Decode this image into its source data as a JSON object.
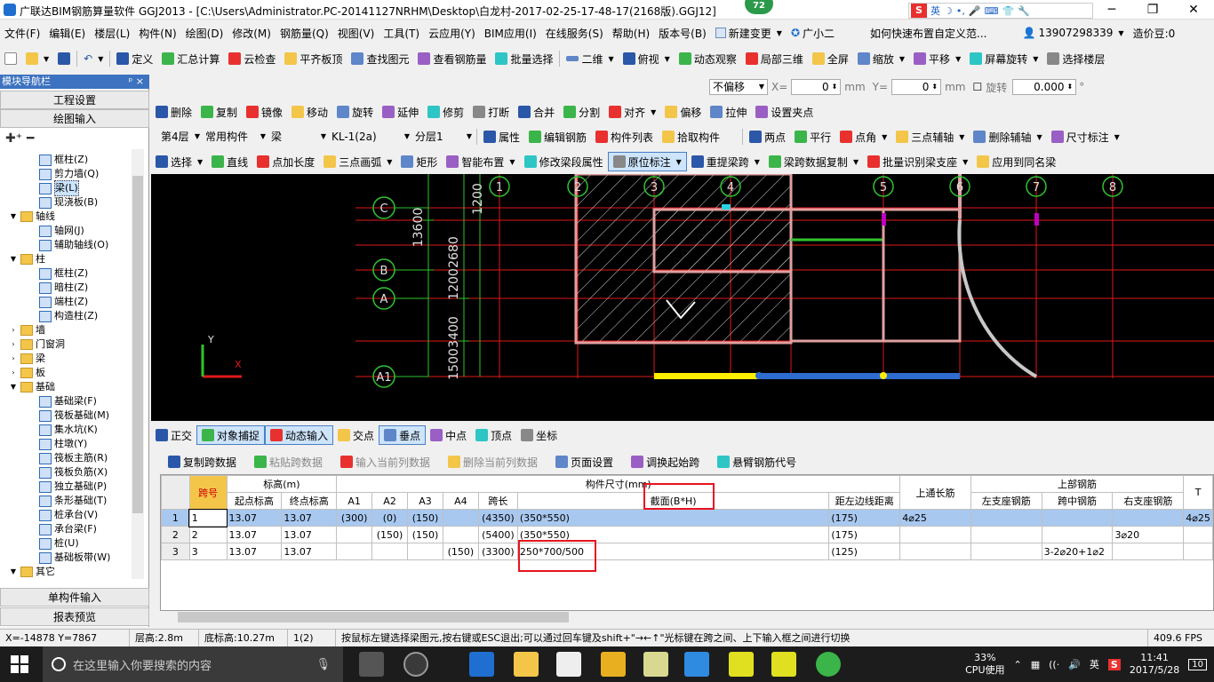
{
  "window": {
    "title": "广联达BIM钢筋算量软件 GGJ2013 - [C:\\Users\\Administrator.PC-20141127NRHM\\Desktop\\白龙村-2017-02-25-17-48-17(2168版).GGJ12]",
    "badge": "72",
    "ime_label": "英",
    "minimize": "─",
    "maximize": "❐",
    "close": "✕"
  },
  "menu": {
    "items": [
      "文件(F)",
      "编辑(E)",
      "楼层(L)",
      "构件(N)",
      "绘图(D)",
      "修改(M)",
      "钢筋量(Q)",
      "视图(V)",
      "工具(T)",
      "云应用(Y)",
      "BIM应用(I)",
      "在线服务(S)",
      "帮助(H)",
      "版本号(B)"
    ],
    "new_change": "新建变更",
    "assistant": "广小二",
    "question": "如何快速布置自定义范...",
    "phone": "13907298339",
    "coins": "造价豆:0"
  },
  "toolbar1": {
    "items": [
      "定义",
      "汇总计算",
      "云检查",
      "平齐板顶",
      "查找图元",
      "查看钢筋量",
      "批量选择"
    ],
    "view_mode": "二维",
    "tools": [
      "俯视",
      "动态观察",
      "局部三维",
      "全屏",
      "缩放",
      "平移",
      "屏幕旋转",
      "选择楼层"
    ]
  },
  "coord": {
    "offset_mode": "不偏移",
    "x_label": "X=",
    "x_value": "0",
    "y_label": "Y=",
    "y_value": "0",
    "unit": "mm",
    "rotate_label": "旋转",
    "rotate_value": "0.000",
    "deg": "°"
  },
  "toolbar2": {
    "items": [
      "删除",
      "复制",
      "镜像",
      "移动",
      "旋转",
      "延伸",
      "修剪",
      "打断",
      "合并",
      "分割",
      "对齐",
      "偏移",
      "拉伸",
      "设置夹点"
    ]
  },
  "toolbar3": {
    "floor": "第4层",
    "category": "常用构件",
    "type": "梁",
    "member": "KL-1(2a)",
    "layer": "分层1",
    "items": [
      "属性",
      "编辑钢筋",
      "构件列表",
      "拾取构件"
    ],
    "aux": [
      "两点",
      "平行",
      "点角",
      "三点辅轴",
      "删除辅轴",
      "尺寸标注"
    ]
  },
  "toolbar4": {
    "items": [
      "选择",
      "直线",
      "点加长度",
      "三点画弧",
      "矩形",
      "智能布置",
      "修改梁段属性",
      "原位标注",
      "重提梁跨",
      "梁跨数据复制",
      "批量识别梁支座",
      "应用到同名梁"
    ]
  },
  "nav": {
    "header": "模块导航栏",
    "pin": "ᵖ ×",
    "project_settings": "工程设置",
    "drawing_input": "绘图输入",
    "single_input": "单构件输入",
    "report": "报表预览",
    "tree": [
      {
        "label": "框柱(Z)",
        "level": 2,
        "kind": "item"
      },
      {
        "label": "剪力墙(Q)",
        "level": 2,
        "kind": "item"
      },
      {
        "label": "梁(L)",
        "level": 2,
        "kind": "item",
        "selected": true
      },
      {
        "label": "现浇板(B)",
        "level": 2,
        "kind": "item"
      },
      {
        "label": "轴线",
        "level": 1,
        "kind": "folder",
        "open": true
      },
      {
        "label": "轴网(J)",
        "level": 2,
        "kind": "item"
      },
      {
        "label": "辅助轴线(O)",
        "level": 2,
        "kind": "item"
      },
      {
        "label": "柱",
        "level": 1,
        "kind": "folder",
        "open": true
      },
      {
        "label": "框柱(Z)",
        "level": 2,
        "kind": "item"
      },
      {
        "label": "暗柱(Z)",
        "level": 2,
        "kind": "item"
      },
      {
        "label": "端柱(Z)",
        "level": 2,
        "kind": "item"
      },
      {
        "label": "构造柱(Z)",
        "level": 2,
        "kind": "item"
      },
      {
        "label": "墙",
        "level": 1,
        "kind": "folder",
        "open": false
      },
      {
        "label": "门窗洞",
        "level": 1,
        "kind": "folder",
        "open": false
      },
      {
        "label": "梁",
        "level": 1,
        "kind": "folder",
        "open": false
      },
      {
        "label": "板",
        "level": 1,
        "kind": "folder",
        "open": false
      },
      {
        "label": "基础",
        "level": 1,
        "kind": "folder",
        "open": true
      },
      {
        "label": "基础梁(F)",
        "level": 2,
        "kind": "item"
      },
      {
        "label": "筏板基础(M)",
        "level": 2,
        "kind": "item"
      },
      {
        "label": "集水坑(K)",
        "level": 2,
        "kind": "item"
      },
      {
        "label": "柱墩(Y)",
        "level": 2,
        "kind": "item"
      },
      {
        "label": "筏板主筋(R)",
        "level": 2,
        "kind": "item"
      },
      {
        "label": "筏板负筋(X)",
        "level": 2,
        "kind": "item"
      },
      {
        "label": "独立基础(P)",
        "level": 2,
        "kind": "item"
      },
      {
        "label": "条形基础(T)",
        "level": 2,
        "kind": "item"
      },
      {
        "label": "桩承台(V)",
        "level": 2,
        "kind": "item"
      },
      {
        "label": "承台梁(F)",
        "level": 2,
        "kind": "item"
      },
      {
        "label": "桩(U)",
        "level": 2,
        "kind": "item"
      },
      {
        "label": "基础板带(W)",
        "level": 2,
        "kind": "item"
      },
      {
        "label": "其它",
        "level": 1,
        "kind": "folder",
        "open": true
      }
    ]
  },
  "drawing": {
    "axis_numbers": [
      "1",
      "2",
      "3",
      "4",
      "5",
      "6",
      "7",
      "8"
    ],
    "axis_letters": [
      "C",
      "B",
      "A",
      "A1"
    ],
    "dims_left": [
      "13600",
      "2680",
      "1200",
      "3400",
      "1500"
    ],
    "dims_top": [
      "1200",
      "13600"
    ],
    "ucs_x": "X",
    "ucs_y": "Y"
  },
  "snap": {
    "items": [
      "正交",
      "对象捕捉",
      "动态输入",
      "交点",
      "垂点",
      "中点",
      "顶点",
      "坐标"
    ]
  },
  "gridtools": {
    "items": [
      "复制跨数据",
      "粘贴跨数据",
      "输入当前列数据",
      "删除当前列数据",
      "页面设置",
      "调换起始跨",
      "悬臂钢筋代号"
    ]
  },
  "table": {
    "group_headers": {
      "elev": "标高(m)",
      "size": "构件尺寸(mm)",
      "top": "上部钢筋"
    },
    "headers": [
      "跨号",
      "起点标高",
      "终点标高",
      "A1",
      "A2",
      "A3",
      "A4",
      "跨长",
      "截面(B*H)",
      "距左边线距离",
      "上通长筋",
      "左支座钢筋",
      "跨中钢筋",
      "右支座钢筋",
      "T"
    ],
    "rows": [
      {
        "n": "1",
        "span": "1",
        "start": "13.07",
        "end": "13.07",
        "a1": "(300)",
        "a2": "(0)",
        "a3": "(150)",
        "a4": "",
        "len": "(4350)",
        "sec": "(350*550)",
        "dist": "(175)",
        "top": "4⌀25",
        "left": "",
        "mid": "",
        "right": "",
        "t": "4⌀25"
      },
      {
        "n": "2",
        "span": "2",
        "start": "13.07",
        "end": "13.07",
        "a1": "",
        "a2": "(150)",
        "a3": "(150)",
        "a4": "",
        "len": "(5400)",
        "sec": "(350*550)",
        "dist": "(175)",
        "top": "",
        "left": "",
        "mid": "",
        "right": "3⌀20",
        "t": ""
      },
      {
        "n": "3",
        "span": "3",
        "start": "13.07",
        "end": "13.07",
        "a1": "",
        "a2": "",
        "a3": "",
        "a4": "(150)",
        "len": "(3300)",
        "sec": "250*700/500",
        "dist": "(125)",
        "top": "",
        "left": "",
        "mid": "3-2⌀20+1⌀2",
        "right": "",
        "t": ""
      }
    ]
  },
  "status": {
    "coords": "X=-14878  Y=7867",
    "floor_height": "层高:2.8m",
    "bottom_elev": "底标高:10.27m",
    "count": "1(2)",
    "hint": "按鼠标左键选择梁图元,按右键或ESC退出;可以通过回车键及shift+\"→←↑\"光标键在跨之间、上下输入框之间进行切换",
    "fps": "409.6 FPS"
  },
  "taskbar": {
    "search_placeholder": "在这里输入你要搜索的内容",
    "cpu": "33%",
    "cpu_label": "CPU使用",
    "ime": "英",
    "time": "11:41",
    "date": "2017/5/28",
    "notifications": "10"
  }
}
